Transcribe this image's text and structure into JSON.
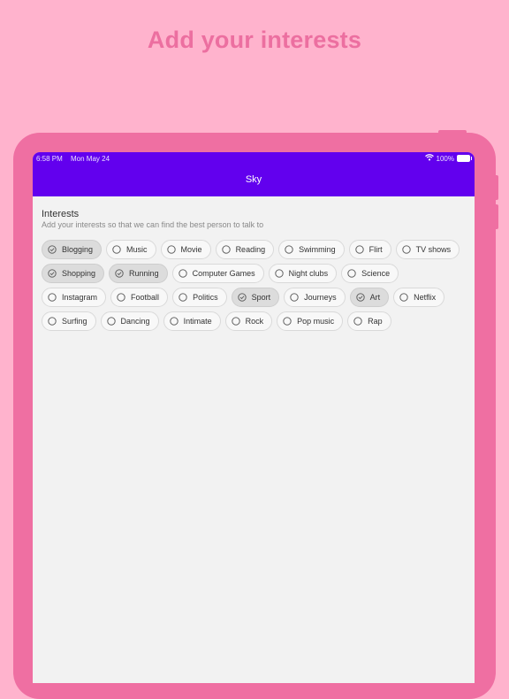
{
  "headline": "Add your interests",
  "status_bar": {
    "time": "6:58 PM",
    "date": "Mon May 24",
    "battery": "100%"
  },
  "app_bar": {
    "title": "Sky"
  },
  "interests": {
    "title": "Interests",
    "subtitle": "Add your interests so that we can find the best person to talk to",
    "rows": [
      [
        {
          "label": "Blogging",
          "selected": true
        },
        {
          "label": "Music",
          "selected": false
        },
        {
          "label": "Movie",
          "selected": false
        },
        {
          "label": "Reading",
          "selected": false
        },
        {
          "label": "Swimming",
          "selected": false
        },
        {
          "label": "Flirt",
          "selected": false
        },
        {
          "label": "TV shows",
          "selected": false
        }
      ],
      [
        {
          "label": "Shopping",
          "selected": true
        },
        {
          "label": "Running",
          "selected": true
        },
        {
          "label": "Computer Games",
          "selected": false
        },
        {
          "label": "Night clubs",
          "selected": false
        },
        {
          "label": "Science",
          "selected": false
        }
      ],
      [
        {
          "label": "Instagram",
          "selected": false
        },
        {
          "label": "Football",
          "selected": false
        },
        {
          "label": "Politics",
          "selected": false
        },
        {
          "label": "Sport",
          "selected": true
        },
        {
          "label": "Journeys",
          "selected": false
        },
        {
          "label": "Art",
          "selected": true
        },
        {
          "label": "Netflix",
          "selected": false
        }
      ],
      [
        {
          "label": "Surfing",
          "selected": false
        },
        {
          "label": "Dancing",
          "selected": false
        },
        {
          "label": "Intimate",
          "selected": false
        },
        {
          "label": "Rock",
          "selected": false
        },
        {
          "label": "Pop music",
          "selected": false
        },
        {
          "label": "Rap",
          "selected": false
        }
      ]
    ]
  },
  "colors": {
    "background": "#FFB3CD",
    "headline": "#EC6FA0",
    "device_frame": "#EF6FA2",
    "app_bar": "#6200EE",
    "screen": "#F2F2F2"
  },
  "icons": {
    "selected": "check-circle-icon",
    "unselected": "radio-circle-icon"
  }
}
